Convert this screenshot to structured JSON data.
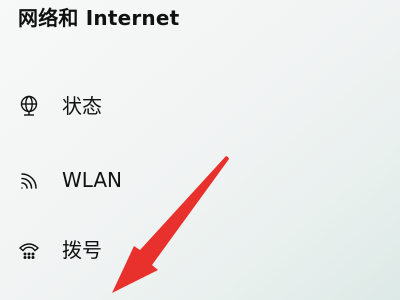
{
  "header": {
    "title": "网络和 Internet"
  },
  "nav": {
    "items": [
      {
        "label": "状态",
        "icon": "globe-status-icon"
      },
      {
        "label": "WLAN",
        "icon": "wifi-icon"
      },
      {
        "label": "拨号",
        "icon": "dial-up-phone-icon"
      }
    ]
  },
  "annotation": {
    "arrow_color": "#e8302c",
    "arrow_icon": "red-pointer-arrow"
  }
}
